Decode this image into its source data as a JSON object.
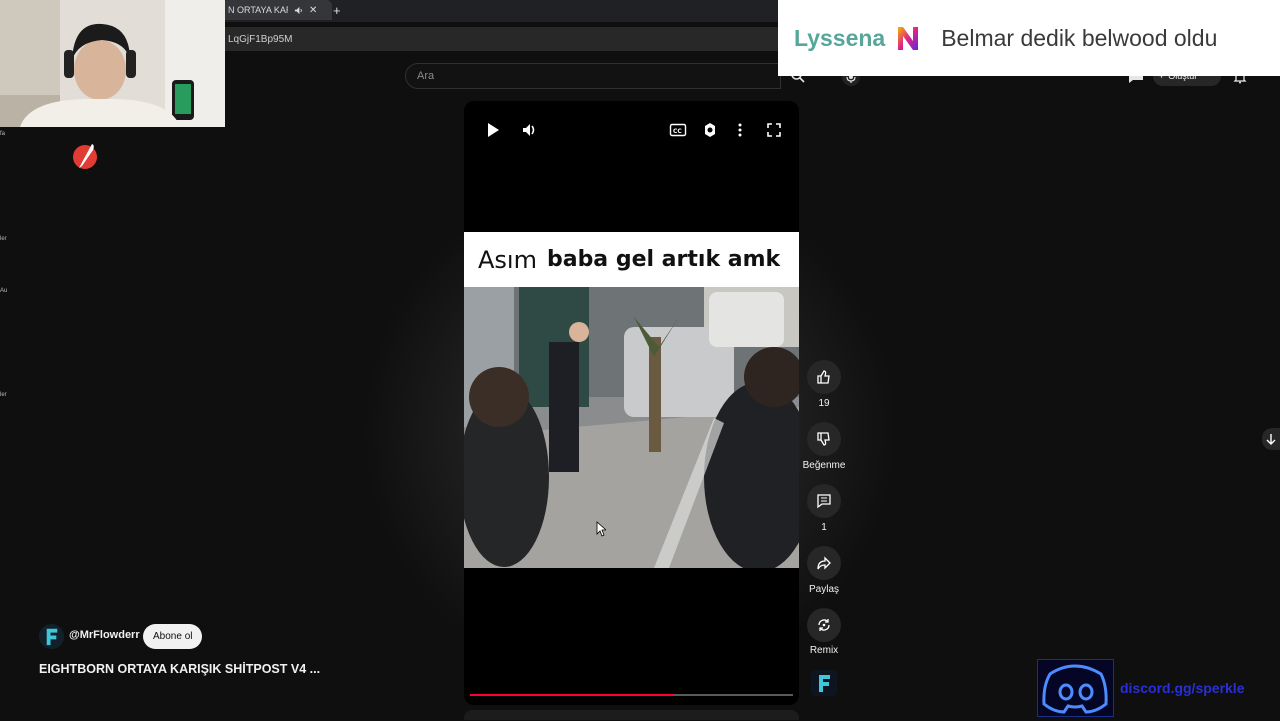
{
  "browser": {
    "tab_title": "N ORTAYA KARIŞ",
    "url_fragment": "LqGjF1Bp95M"
  },
  "header": {
    "search_placeholder": "Ara",
    "create_label": "Oluştur"
  },
  "banner": {
    "name": "Lyssena",
    "message": "Belmar dedik belwood oldu",
    "name_color": "#56a79a"
  },
  "sidebar_fragments": [
    "fa",
    "ler",
    "Au",
    "ler"
  ],
  "video": {
    "caption_speaker": "Asım",
    "caption_text": "baba gel artık amk",
    "progress": 0.63,
    "accent_color": "#ff0033"
  },
  "actions": {
    "likes": "19",
    "dislike_label": "Beğenme",
    "comments": "1",
    "share_label": "Paylaş",
    "remix_label": "Remix"
  },
  "channel": {
    "handle": "@MrFlowderr",
    "subscribe_label": "Abone ol"
  },
  "title": "EIGHTBORN ORTAYA KARIŞIK SHİTPOST V4 ...",
  "discord": {
    "link_text": "discord.gg/sperkle"
  }
}
